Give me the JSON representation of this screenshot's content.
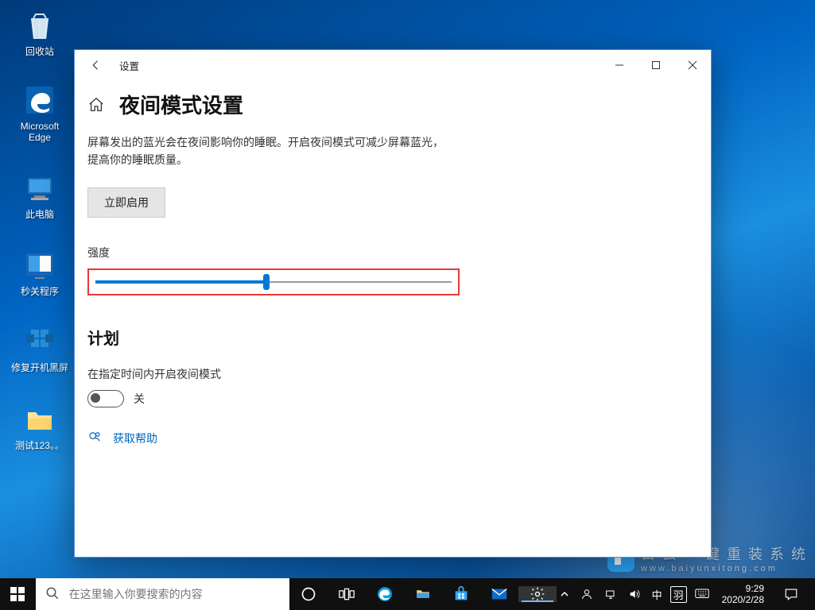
{
  "desktop": {
    "icons": [
      {
        "name": "recycle-bin",
        "label": "回收站"
      },
      {
        "name": "edge",
        "label": "Microsoft Edge"
      },
      {
        "name": "this-pc",
        "label": "此电脑"
      },
      {
        "name": "shutdown-tool",
        "label": "秒关程序"
      },
      {
        "name": "repair-boot",
        "label": "修复开机黑屏"
      },
      {
        "name": "test-folder",
        "label": "测试123。。"
      }
    ]
  },
  "settings_window": {
    "back_hint": "返回",
    "title": "设置",
    "minimize": "–",
    "maximize": "□",
    "close": "×",
    "page_title": "夜间模式设置",
    "description_line1": "屏幕发出的蓝光会在夜间影响你的睡眠。开启夜间模式可减少屏幕蓝光，",
    "description_line2": "提高你的睡眠质量。",
    "enable_button": "立即启用",
    "strength_label": "强度",
    "strength_value": 48,
    "schedule_title": "计划",
    "schedule_desc": "在指定时间内开启夜间模式",
    "toggle_state": "关",
    "help_link": "获取帮助"
  },
  "taskbar": {
    "search_placeholder": "在这里输入你要搜索的内容",
    "tray": {
      "ime": "中",
      "ime2": "羽",
      "time": "9:29",
      "date": "2020/2/28"
    }
  },
  "watermark": {
    "text1": "白 云 一 键 重 装 系 统",
    "text2": "www.baiyunxitong.com"
  }
}
